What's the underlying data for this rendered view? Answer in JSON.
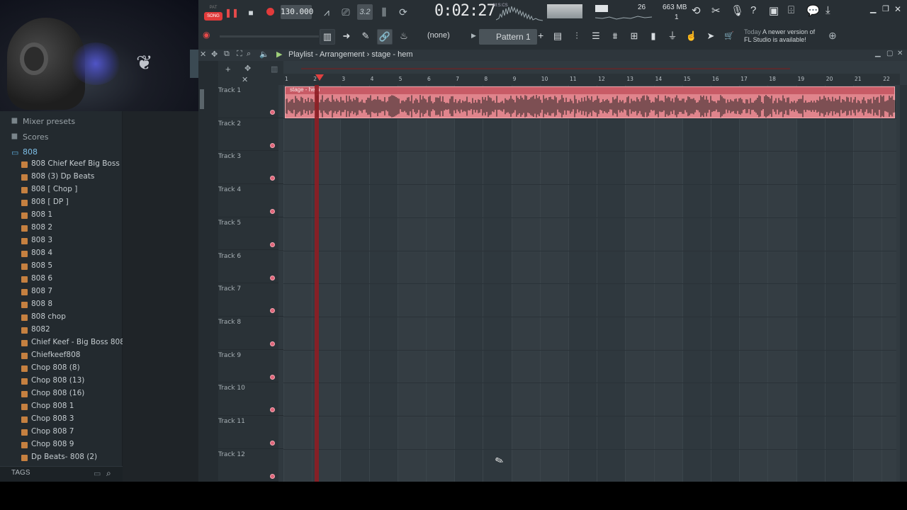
{
  "toolbar": {
    "pat_label": "PAT",
    "song_label": "SONG",
    "tempo": "130.000",
    "pattern_len": "3.2",
    "time": "0:02:27",
    "time_sub": "M:S:CS",
    "cpu": "26",
    "memory": "663 MB",
    "polyphony": "1",
    "none_label": "(none)",
    "pattern": "Pattern 1",
    "notify_date": "Today",
    "notify_text_1": "A newer version of",
    "notify_text_2": "FL Studio is available!"
  },
  "playlist": {
    "title_app": "Playlist - Arrangement",
    "title_sep": "›",
    "title_pattern": "stage - hem",
    "clip_label": "stage - hem"
  },
  "timeline_ticks": [
    "1",
    "2",
    "3",
    "4",
    "5",
    "6",
    "7",
    "8",
    "9",
    "10",
    "11",
    "12",
    "13",
    "14",
    "15",
    "16",
    "17",
    "18",
    "19",
    "20",
    "21",
    "22"
  ],
  "tracks": [
    "Track 1",
    "Track 2",
    "Track 3",
    "Track 4",
    "Track 5",
    "Track 6",
    "Track 7",
    "Track 8",
    "Track 9",
    "Track 10",
    "Track 11",
    "Track 12"
  ],
  "browser": {
    "folders": [
      {
        "label": "Mixer presets",
        "open": false
      },
      {
        "label": "Scores",
        "open": false
      },
      {
        "label": "808",
        "open": true
      }
    ],
    "items": [
      "808  Chief Keef Big Boss",
      "808 (3) Dp Beats",
      "808 [ Chop ]",
      "808 [ DP ]",
      "808 1",
      "808 2",
      "808 3",
      "808 4",
      "808 5",
      "808 6",
      "808 7",
      "808 8",
      "808 chop",
      "8082",
      "Chief Keef - Big Boss 808",
      "Chiefkeef808",
      "Chop 808 (8)",
      "Chop 808 (13)",
      "Chop 808 (16)",
      "Chop 808 1",
      "Chop 808 3",
      "Chop 808 7",
      "Chop 808 9",
      "Dp Beats- 808 (2)"
    ],
    "tags_label": "TAGS"
  },
  "colors": {
    "accent_red": "#e23b3b",
    "clip_fill": "#e0848c",
    "folder_open": "#7fc0e8"
  }
}
